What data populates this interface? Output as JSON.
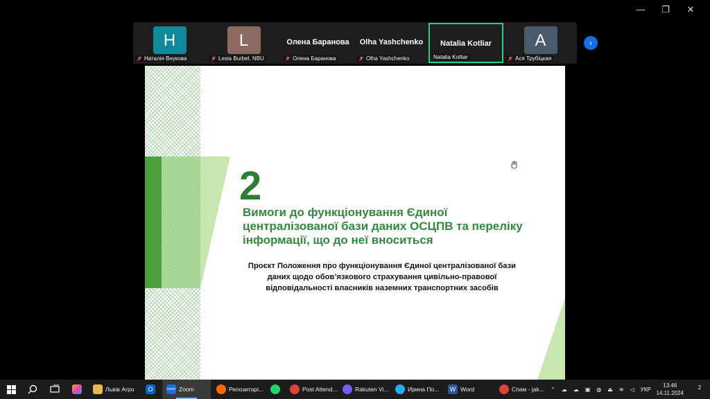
{
  "window": {
    "minimize": "—",
    "restore": "❐",
    "close": "✕"
  },
  "participants": [
    {
      "avatar": "H",
      "color": "#0e8a9a",
      "label": "Наталія Внукова"
    },
    {
      "avatar": "L",
      "color": "#8b6a5f",
      "label": "Lesia Burbel, NBU"
    },
    {
      "title": "Олена Баранова",
      "label": "Олена Баранова"
    },
    {
      "title": "Olha Yashchenko",
      "label": "Olha Yashchenko"
    },
    {
      "title": "Natalia Kotliar",
      "label": "Natalia Kotliar",
      "active": true
    },
    {
      "avatar": "A",
      "color": "#4a5a6a",
      "label": "Ася Трубіцкая"
    }
  ],
  "next_icon": "›",
  "slide": {
    "number": "2",
    "heading": "Вимоги до функціонування Єдиної централізованої бази даних ОСЦПВ та переліку інформації, що до неї вноситься",
    "body": "Проєкт Положення про функціонування Єдиної централізованої бази даних щодо обов’язкового страхування цивільно-правової відповідальності власників наземних транспортних засобів"
  },
  "taskbar": {
    "items": [
      {
        "icon": "folder-icon",
        "label": "Львів Агро",
        "color": "#e8b84a"
      },
      {
        "icon": "outlook-icon",
        "label": "",
        "color": "#0a64c8"
      },
      {
        "icon": "zoom-icon",
        "label": "Zoom",
        "color": "#0e71eb",
        "active": true
      },
      {
        "icon": "browser-icon",
        "label": "Репозитарі...",
        "color": "#ff6a00"
      },
      {
        "icon": "whatsapp-icon",
        "label": "",
        "color": "#25d366"
      },
      {
        "icon": "chrome-icon",
        "label": "Post Attend...",
        "color": "#db4437"
      },
      {
        "icon": "viber-icon",
        "label": "Rakuten Vi...",
        "color": "#7360f2"
      },
      {
        "icon": "telegram-icon",
        "label": "Ирина По...",
        "color": "#2aabee"
      },
      {
        "icon": "word-icon",
        "label": "Word",
        "color": "#2b579a"
      },
      {
        "icon": "chrome-icon",
        "label": "Спам - jak...",
        "color": "#db4437"
      }
    ],
    "lang": "УКР",
    "time": "13:46",
    "date": "14.11.2024",
    "notifications": "2"
  }
}
